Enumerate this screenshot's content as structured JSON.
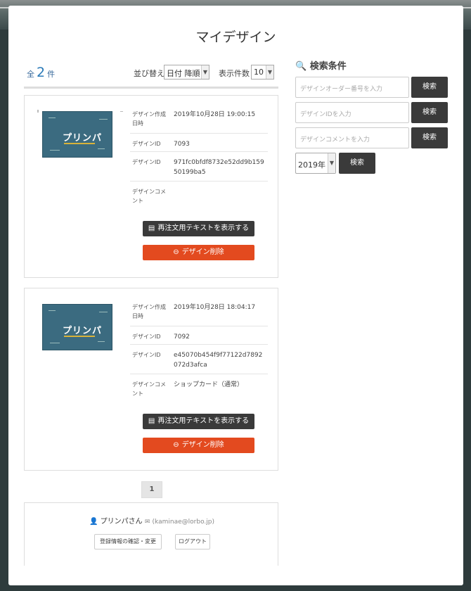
{
  "modal": {
    "title": "マイデザイン"
  },
  "list": {
    "count_prefix": "全",
    "count": "2",
    "count_suffix": "件",
    "sort_label": "並び替え",
    "sort_value": "日付 降順",
    "perpage_label": "表示件数",
    "perpage_value": "10"
  },
  "fields": {
    "created": "デザイン作成日時",
    "order_id": "デザインID",
    "design_id": "デザインID",
    "comment": "デザインコメント"
  },
  "designs": [
    {
      "logo": "プリンパ",
      "created": "2019年10月28日 19:00:15",
      "order_id": "7093",
      "design_id": "971fc0bfdf8732e52dd9b15950199ba5",
      "comment": "",
      "reorder_label": "再注文用テキストを表示する",
      "delete_label": "デザイン削除"
    },
    {
      "logo": "プリンパ",
      "created": "2019年10月28日 18:04:17",
      "order_id": "7092",
      "design_id": "e45070b454f9f77122d7892072d3afca",
      "comment": "ショップカード（通常）",
      "reorder_label": "再注文用テキストを表示する",
      "delete_label": "デザイン削除"
    }
  ],
  "pagination": {
    "current": "1"
  },
  "user": {
    "name": "プリンパさん",
    "email": "(kaminae@lorbo.jp)",
    "edit_label": "登録情報の確認・変更",
    "logout_label": "ログアウト"
  },
  "search": {
    "title": "検索条件",
    "order_placeholder": "デザインオーダー番号を入力",
    "id_placeholder": "デザインIDを入力",
    "comment_placeholder": "デザインコメントを入力",
    "button_label": "検索",
    "year_value": "2019年"
  },
  "colors": {
    "accent": "#2a7ab8",
    "danger": "#e34a1f",
    "dark": "#3a3a3a"
  }
}
